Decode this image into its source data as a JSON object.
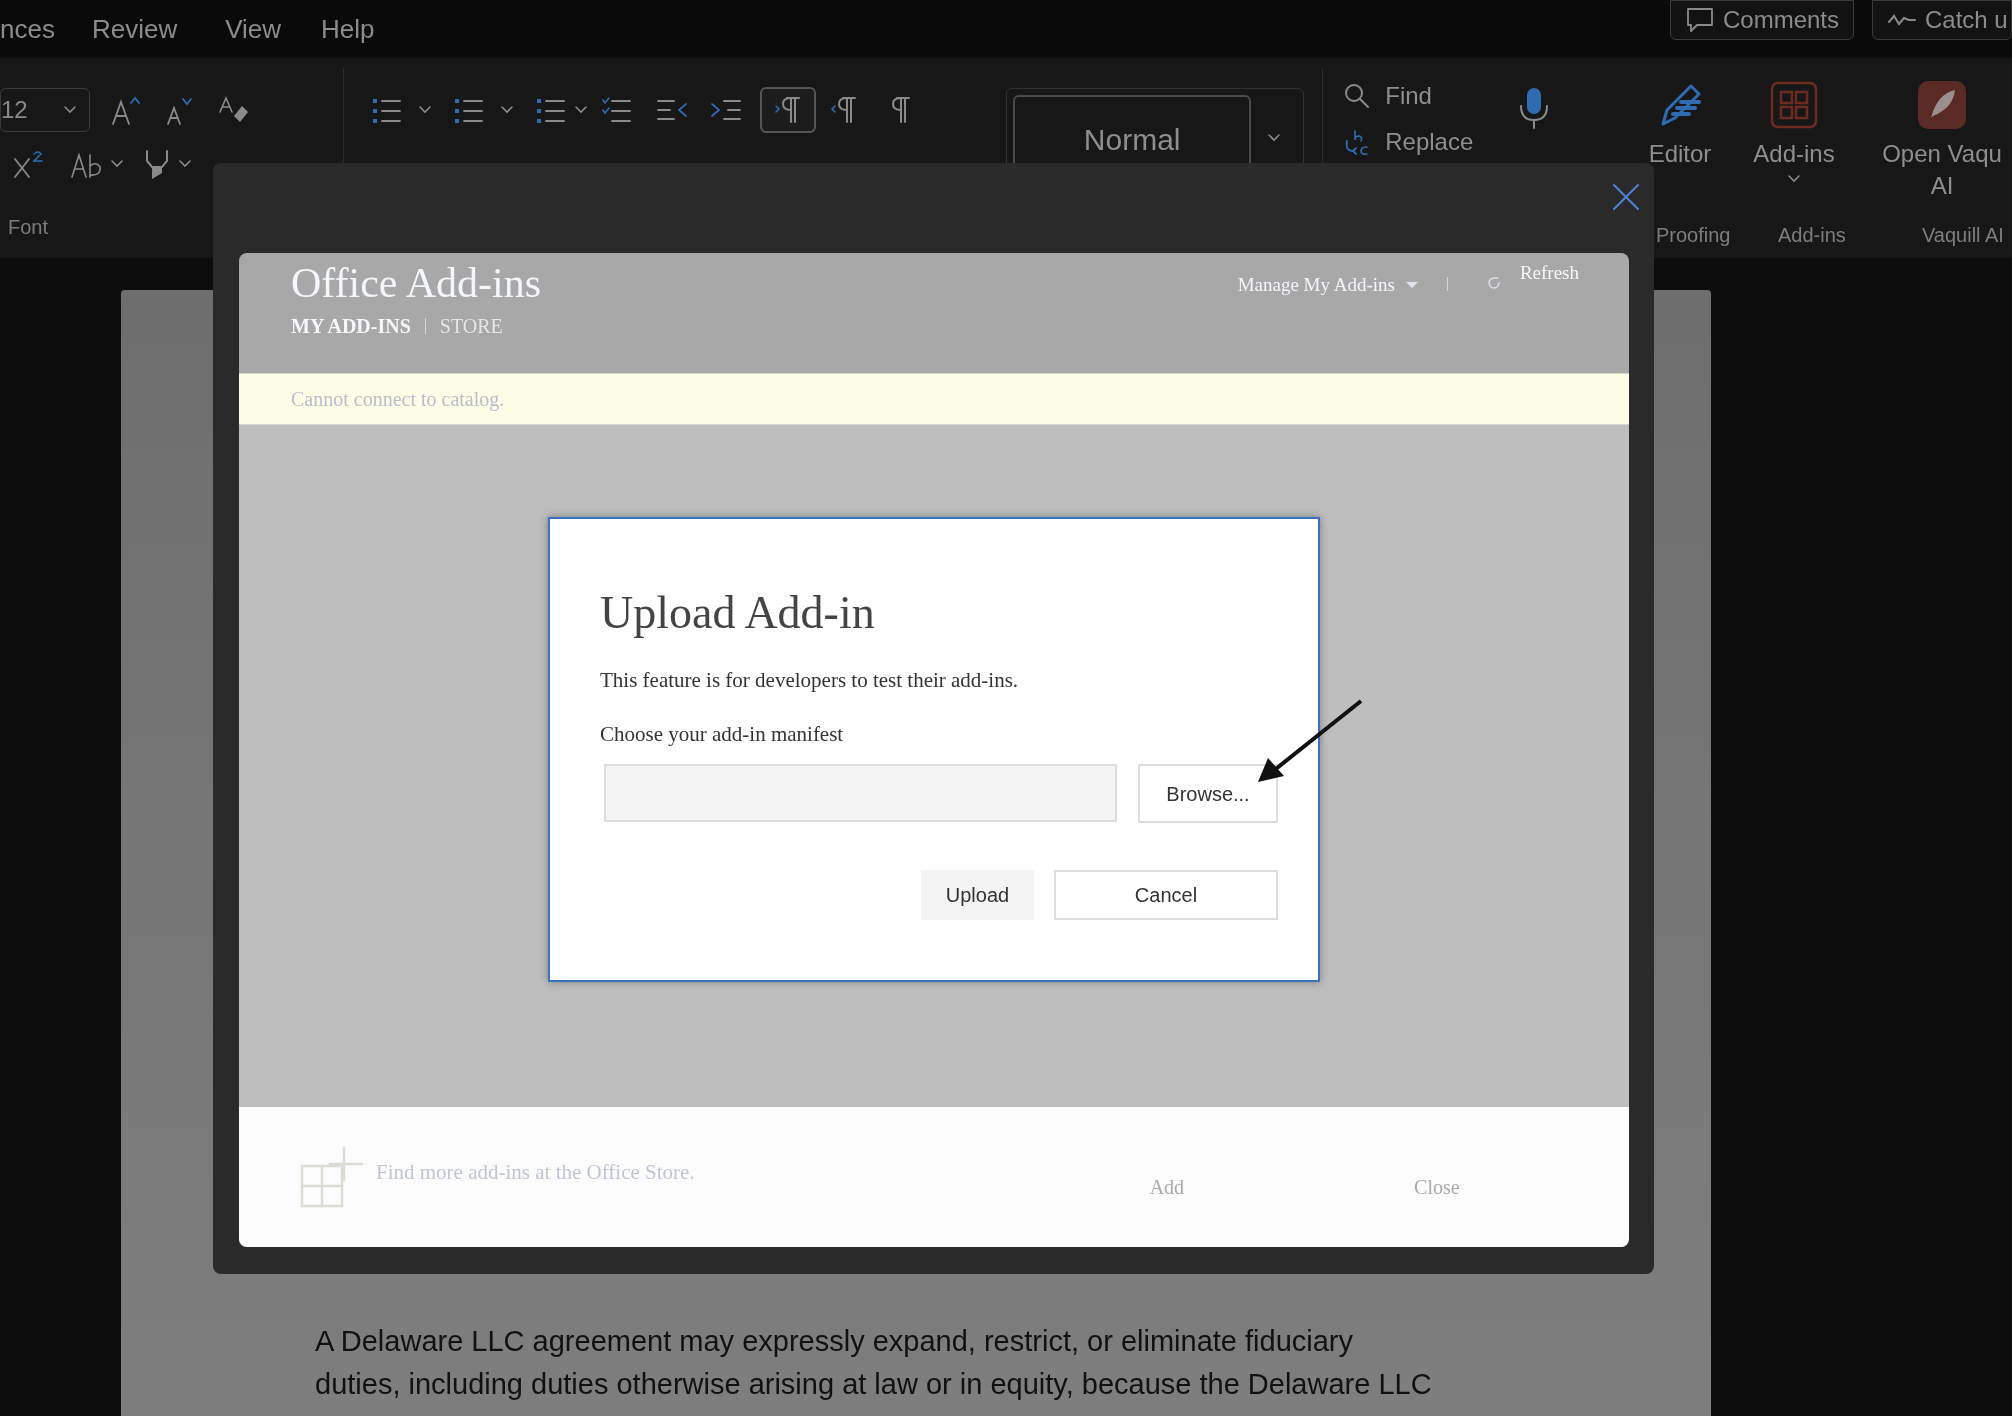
{
  "menu_tabs": [
    {
      "label": "nces"
    },
    {
      "label": "Review"
    },
    {
      "label": "View"
    },
    {
      "label": "Help"
    }
  ],
  "top_buttons": [
    {
      "label": "Comments",
      "kind": "comments"
    },
    {
      "label": "Catch u",
      "kind": "catchup"
    }
  ],
  "ribbon": {
    "font_size": "12",
    "font_group": "Font",
    "paragraph_buttons": [
      {
        "kind": "ltr",
        "selected": true
      },
      {
        "kind": "rtl",
        "selected": false
      },
      {
        "kind": "marks",
        "selected": false
      }
    ],
    "style": "Normal",
    "find": "Find",
    "replace": "Replace",
    "commands": [
      {
        "kind": "editor",
        "lines": [
          "Editor"
        ],
        "group": "Proofing"
      },
      {
        "kind": "addins",
        "lines": [
          "Add-ins"
        ],
        "group": "Add-ins"
      },
      {
        "kind": "vaquill",
        "lines": [
          "Open Vaqu",
          "AI"
        ],
        "group": "Vaquill AI"
      }
    ]
  },
  "addins_dialog": {
    "title": "Office Add-ins",
    "tabs": [
      {
        "label": "MY ADD-INS",
        "selected": true
      },
      {
        "label": "STORE",
        "selected": false
      }
    ],
    "manage": "Manage My Add-ins",
    "refresh": "Refresh",
    "notice": "Cannot connect to catalog.",
    "store_link": "Find more add-ins at the Office Store.",
    "buttons": [
      "Add",
      "Close"
    ]
  },
  "upload_dialog": {
    "title": "Upload Add-in",
    "description": "This feature is for developers to test their add-ins.",
    "field_label": "Choose your add-in manifest",
    "browse": "Browse...",
    "buttons": [
      {
        "label": "Upload",
        "kind": "primary"
      },
      {
        "label": "Cancel",
        "kind": "secondary"
      }
    ]
  },
  "document": {
    "lines": [
      "A Delaware LLC agreement may expressly expand, restrict, or eliminate fiduciary",
      "duties, including duties otherwise arising at law or in equity, because the Delaware LLC"
    ]
  }
}
